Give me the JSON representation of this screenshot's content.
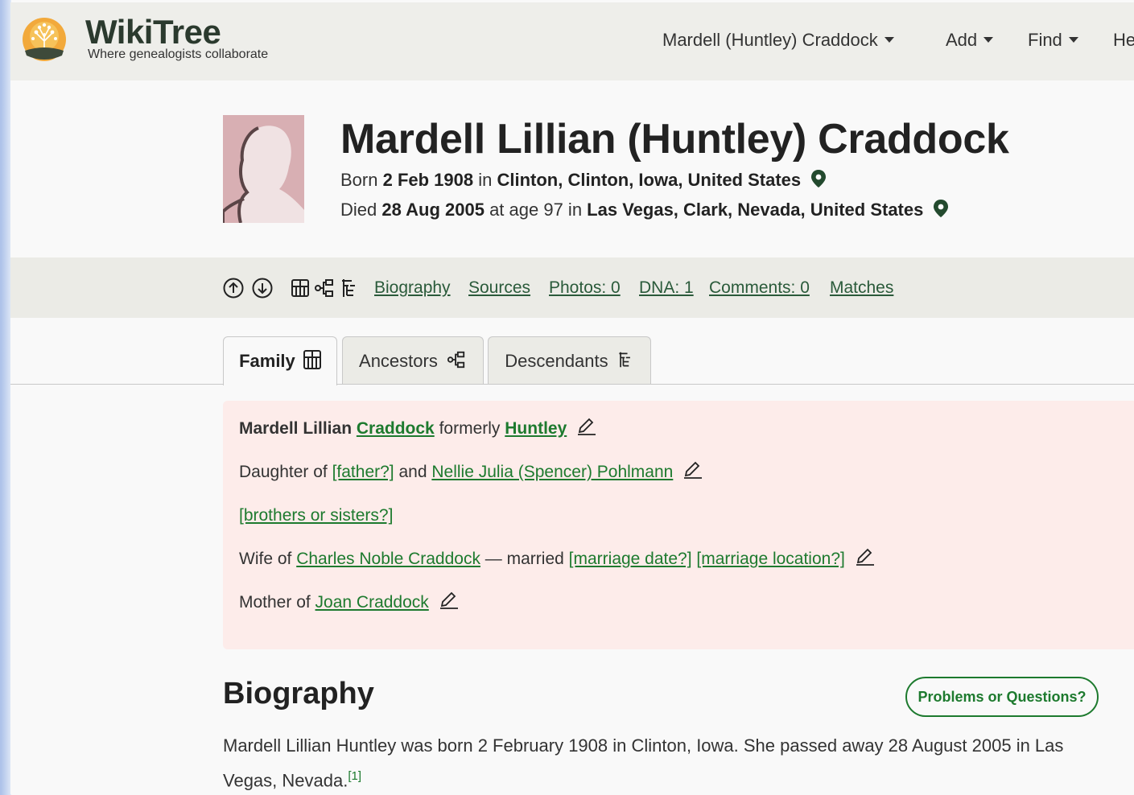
{
  "header": {
    "brand": "WikiTree",
    "tagline": "Where genealogists collaborate",
    "nav": [
      {
        "label": "Mardell (Huntley) Craddock"
      },
      {
        "label": "Add"
      },
      {
        "label": "Find"
      },
      {
        "label": "He"
      }
    ]
  },
  "profile": {
    "name": "Mardell Lillian (Huntley) Craddock",
    "born": {
      "prefix": "Born ",
      "date": "2 Feb 1908",
      "mid": " in ",
      "place": "Clinton, Clinton, Iowa, United States"
    },
    "died": {
      "prefix": "Died ",
      "date": "28 Aug 2005",
      "mid": " at age 97 in ",
      "place": "Las Vegas, Clark, Nevada, United States"
    }
  },
  "toolbar": {
    "links": [
      "Biography",
      "Sources",
      "Photos: 0",
      "DNA: 1",
      "Comments: 0",
      "Matches"
    ],
    "icons": [
      "arrow-up-circle-icon",
      "arrow-down-circle-icon",
      "family-grid-icon",
      "ancestors-tree-icon",
      "descendants-tree-icon"
    ]
  },
  "tabs": [
    {
      "label": "Family",
      "active": true
    },
    {
      "label": "Ancestors",
      "active": false
    },
    {
      "label": "Descendants",
      "active": false
    }
  ],
  "family": {
    "name_line": {
      "first": "Mardell Lillian ",
      "surname": "Craddock",
      "mid": " formerly ",
      "maiden": "Huntley"
    },
    "daughter_line": {
      "prefix": "Daughter of ",
      "father": "[father?]",
      "and": " and ",
      "mother": "Nellie Julia (Spencer) Pohlmann"
    },
    "siblings": "[brothers or sisters?]",
    "wife_line": {
      "prefix": "Wife of ",
      "husband": "Charles Noble Craddock",
      "mid": " — married ",
      "date": "[marriage date?]",
      "location": "[marriage location?]"
    },
    "mother_line": {
      "prefix": "Mother of ",
      "child": "Joan Craddock"
    }
  },
  "biography": {
    "heading": "Biography",
    "button": "Problems or Questions?",
    "text": "Mardell Lillian Huntley was born 2 February 1908 in Clinton, Iowa. She passed away 28 August 2005 in Las Vegas, Nevada.",
    "footnote": "[1]"
  },
  "colors": {
    "link_green": "#1d7a2e",
    "family_bg": "#fdecea",
    "avatar_bg": "#d8afb3"
  }
}
